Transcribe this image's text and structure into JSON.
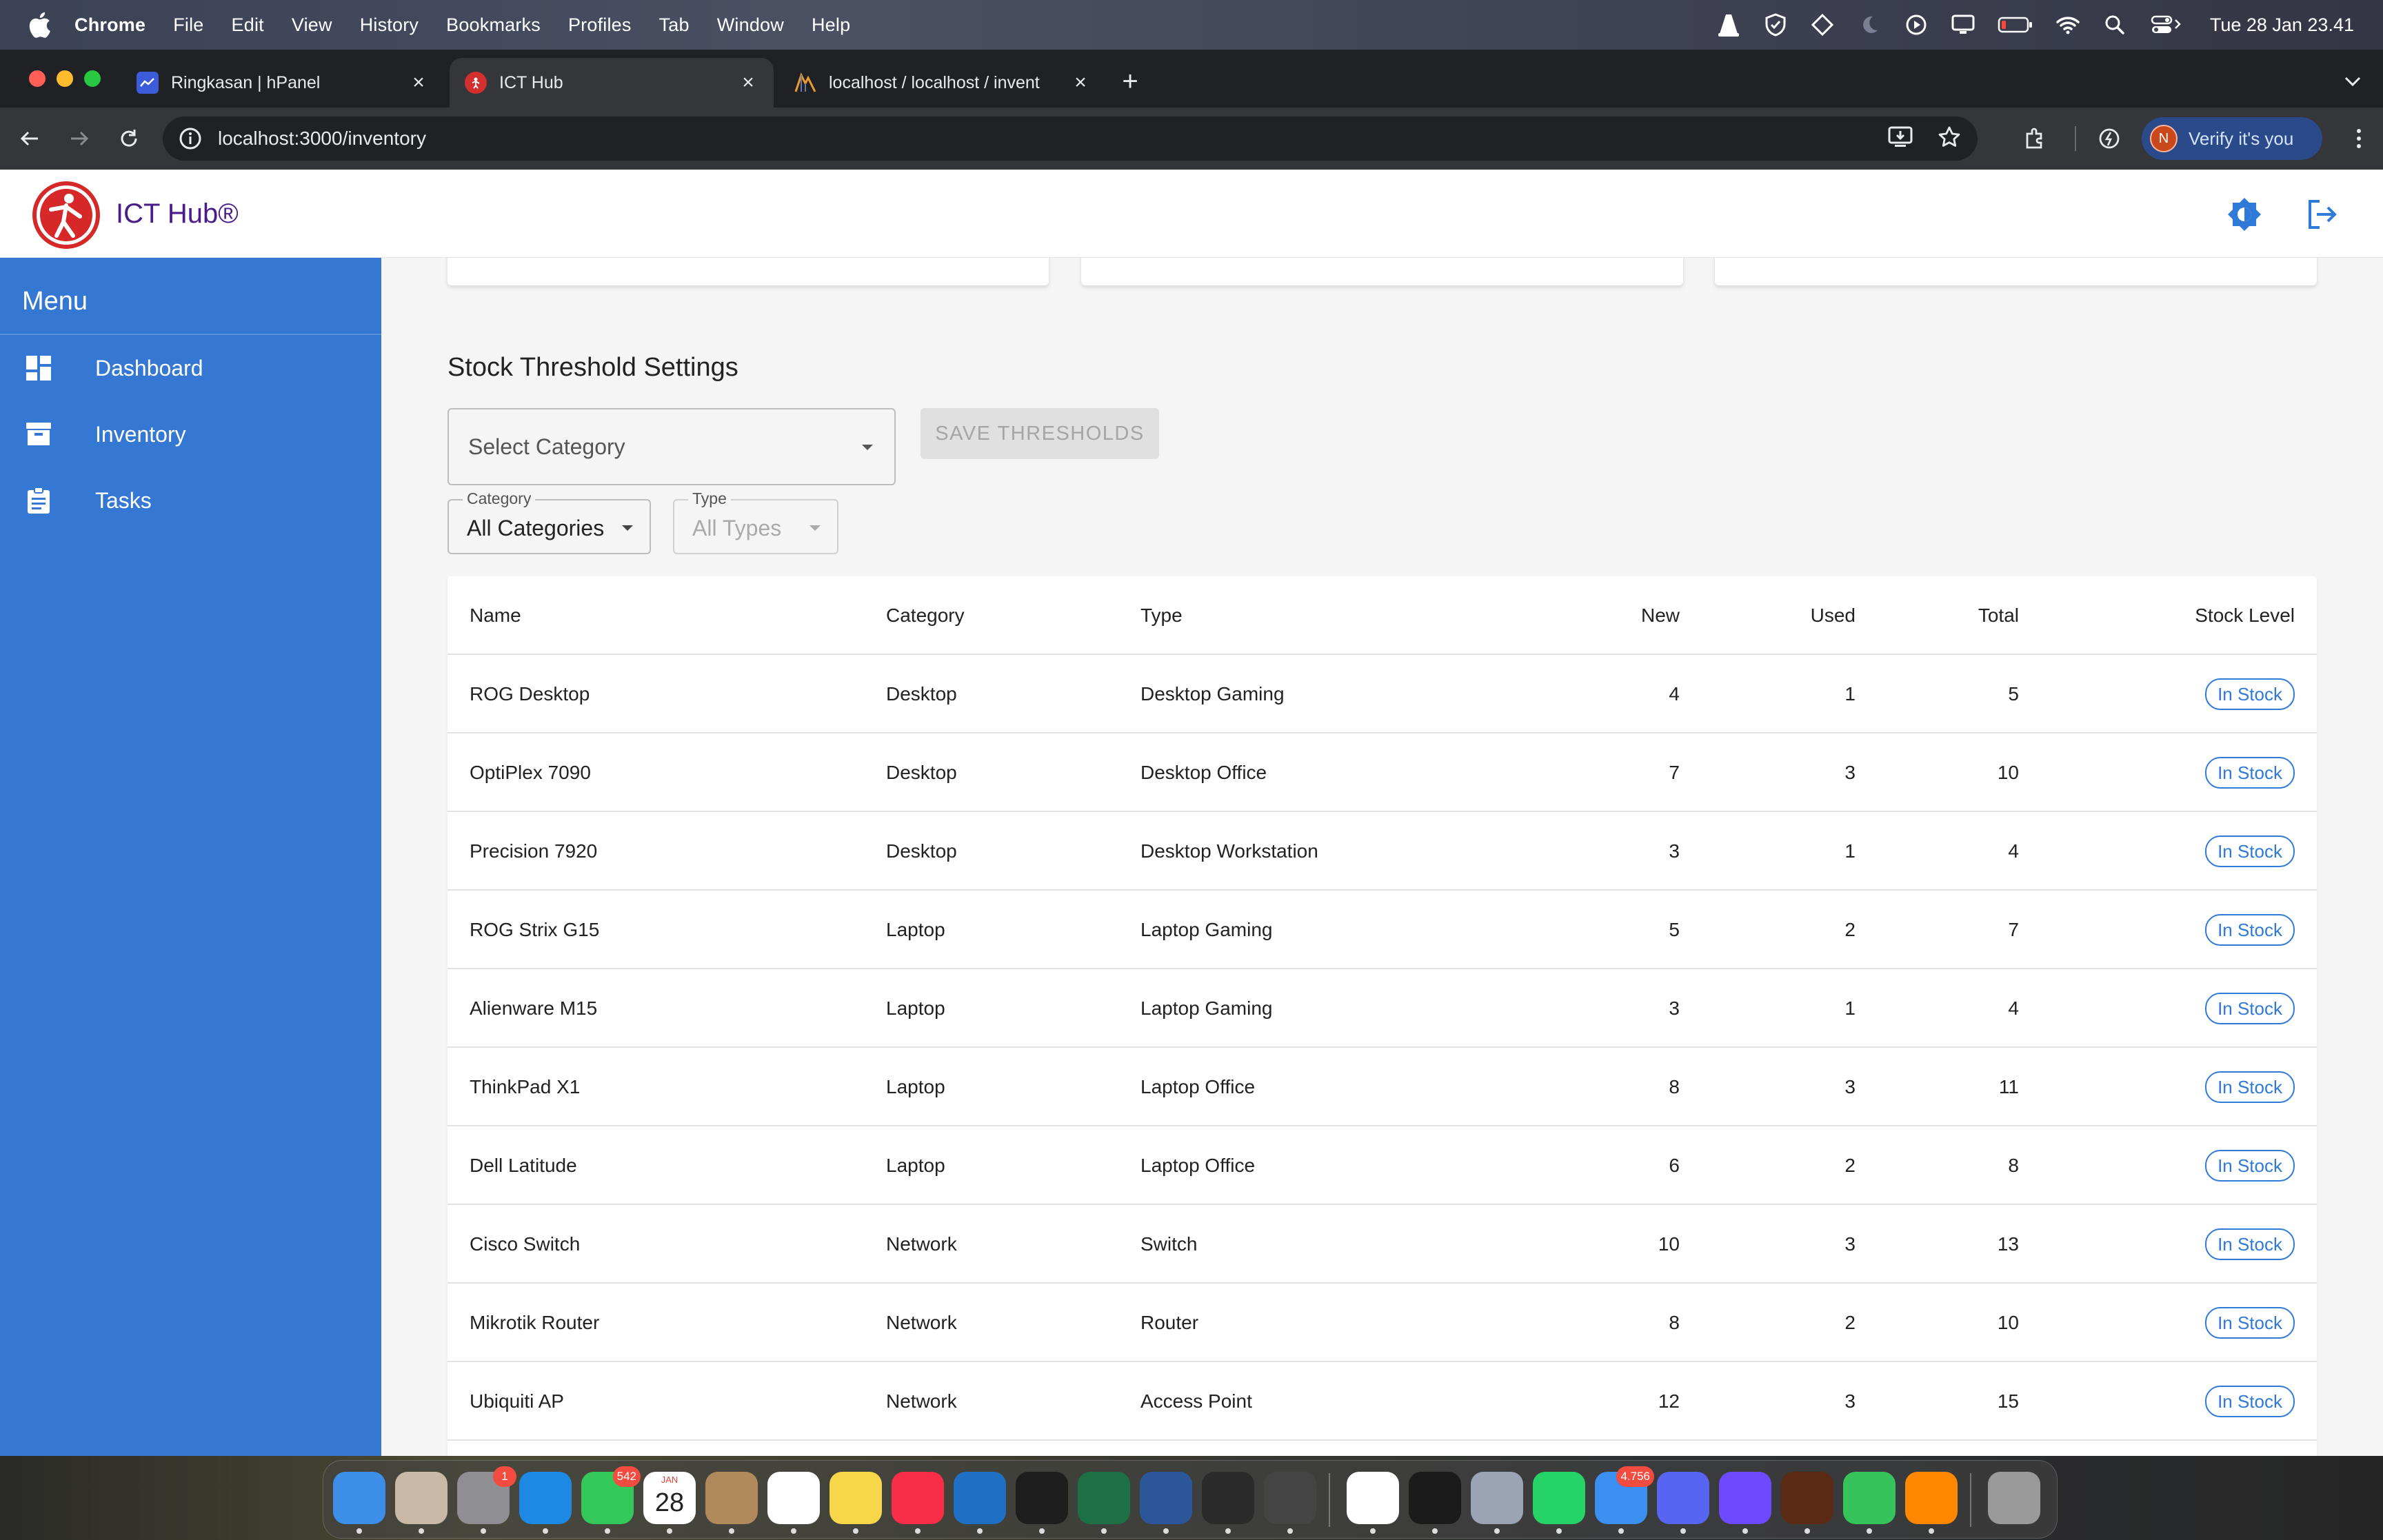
{
  "menubar": {
    "app_name": "Chrome",
    "items": [
      "File",
      "Edit",
      "View",
      "History",
      "Bookmarks",
      "Profiles",
      "Tab",
      "Window",
      "Help"
    ],
    "clock": "Tue 28 Jan  23.41"
  },
  "browser": {
    "tabs": [
      {
        "title": "Ringkasan | hPanel",
        "favicon_color": "#3c5bd8"
      },
      {
        "title": "ICT Hub",
        "favicon_color": "#d32f2f"
      },
      {
        "title": "localhost / localhost / invent",
        "favicon_color": "#e89c2c"
      }
    ],
    "url": "localhost:3000/inventory",
    "verify_label": "Verify it's you",
    "profile_initial": "N"
  },
  "app": {
    "brand": "ICT Hub®",
    "sidebar": {
      "title": "Menu",
      "items": [
        {
          "label": "Dashboard",
          "icon": "dashboard-icon"
        },
        {
          "label": "Inventory",
          "icon": "inventory-icon"
        },
        {
          "label": "Tasks",
          "icon": "clipboard-icon"
        }
      ]
    },
    "threshold": {
      "title": "Stock Threshold Settings",
      "select_placeholder": "Select Category",
      "save_label": "SAVE THRESHOLDS"
    },
    "filters": {
      "category": {
        "label": "Category",
        "value": "All Categories"
      },
      "type": {
        "label": "Type",
        "value": "All Types"
      }
    },
    "table": {
      "headers": [
        "Name",
        "Category",
        "Type",
        "New",
        "Used",
        "Total",
        "Stock Level"
      ],
      "rows": [
        {
          "name": "ROG Desktop",
          "category": "Desktop",
          "type": "Desktop Gaming",
          "new": "4",
          "used": "1",
          "total": "5",
          "stock": "In Stock"
        },
        {
          "name": "OptiPlex 7090",
          "category": "Desktop",
          "type": "Desktop Office",
          "new": "7",
          "used": "3",
          "total": "10",
          "stock": "In Stock"
        },
        {
          "name": "Precision 7920",
          "category": "Desktop",
          "type": "Desktop Workstation",
          "new": "3",
          "used": "1",
          "total": "4",
          "stock": "In Stock"
        },
        {
          "name": "ROG Strix G15",
          "category": "Laptop",
          "type": "Laptop Gaming",
          "new": "5",
          "used": "2",
          "total": "7",
          "stock": "In Stock"
        },
        {
          "name": "Alienware M15",
          "category": "Laptop",
          "type": "Laptop Gaming",
          "new": "3",
          "used": "1",
          "total": "4",
          "stock": "In Stock"
        },
        {
          "name": "ThinkPad X1",
          "category": "Laptop",
          "type": "Laptop Office",
          "new": "8",
          "used": "3",
          "total": "11",
          "stock": "In Stock"
        },
        {
          "name": "Dell Latitude",
          "category": "Laptop",
          "type": "Laptop Office",
          "new": "6",
          "used": "2",
          "total": "8",
          "stock": "In Stock"
        },
        {
          "name": "Cisco Switch",
          "category": "Network",
          "type": "Switch",
          "new": "10",
          "used": "3",
          "total": "13",
          "stock": "In Stock"
        },
        {
          "name": "Mikrotik Router",
          "category": "Network",
          "type": "Router",
          "new": "8",
          "used": "2",
          "total": "10",
          "stock": "In Stock"
        },
        {
          "name": "Ubiquiti AP",
          "category": "Network",
          "type": "Access Point",
          "new": "12",
          "used": "3",
          "total": "15",
          "stock": "In Stock"
        }
      ]
    }
  },
  "dock": {
    "apps": [
      {
        "name": "finder-icon",
        "color": "#3d8ee8"
      },
      {
        "name": "launchpad-icon",
        "color": "#c9b9a6"
      },
      {
        "name": "system-settings-icon",
        "color": "#8e8e93",
        "badge": "1"
      },
      {
        "name": "safari-icon",
        "color": "#1e88e5"
      },
      {
        "name": "messages-icon",
        "color": "#34c759",
        "badge": "542"
      },
      {
        "name": "calendar-icon",
        "color": "#ffffff",
        "text": "28",
        "subtext": "JAN"
      },
      {
        "name": "contacts-icon",
        "color": "#b08a5a"
      },
      {
        "name": "reminders-icon",
        "color": "#ffffff"
      },
      {
        "name": "notes-icon",
        "color": "#f7d64a"
      },
      {
        "name": "music-icon",
        "color": "#fa2d48"
      },
      {
        "name": "vscode-icon",
        "color": "#1f6fc5"
      },
      {
        "name": "figma-icon",
        "color": "#1e1e1e"
      },
      {
        "name": "excel-icon",
        "color": "#1d7044"
      },
      {
        "name": "word-icon",
        "color": "#2b579a"
      },
      {
        "name": "terminal-icon",
        "color": "#2b2b2b"
      },
      {
        "name": "calculator-icon",
        "color": "#444444"
      },
      {
        "name": "chrome-icon",
        "color": "#ffffff"
      },
      {
        "name": "cursor-icon",
        "color": "#1b1b1b"
      },
      {
        "name": "settings-gear-icon",
        "color": "#9aa4b4"
      },
      {
        "name": "whatsapp-icon",
        "color": "#25d366"
      },
      {
        "name": "mail-icon",
        "color": "#3b8ff0",
        "badge": "4.756"
      },
      {
        "name": "discord-icon",
        "color": "#5865f2"
      },
      {
        "name": "proton-icon",
        "color": "#6d4aff"
      },
      {
        "name": "game-icon",
        "color": "#5a2a14"
      },
      {
        "name": "find-my-icon",
        "color": "#37c35b"
      },
      {
        "name": "vlc-icon",
        "color": "#ff8800"
      },
      {
        "name": "trash-icon",
        "color": "#9a9a9a"
      }
    ]
  }
}
